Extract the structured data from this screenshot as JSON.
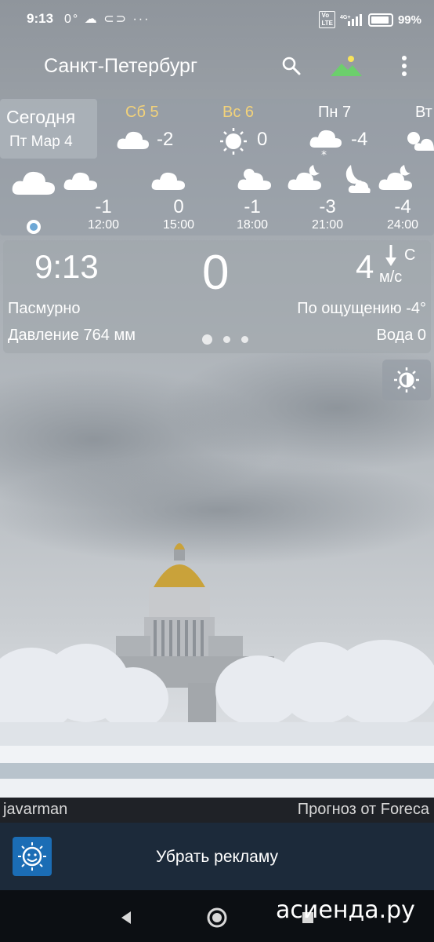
{
  "status_bar": {
    "time": "9:13",
    "temp_icon_text": "0°",
    "battery": "99%"
  },
  "header": {
    "city": "Санкт-Петербург"
  },
  "today": {
    "line1": "Сегодня",
    "line2": "Пт Мар 4"
  },
  "days": [
    {
      "name": "Сб 5",
      "temp": "-2",
      "icon": "cloudy-icon",
      "color": "#f2d27a"
    },
    {
      "name": "Вс 6",
      "temp": "0",
      "icon": "sun-icon",
      "color": "#f2d27a"
    },
    {
      "name": "Пн 7",
      "temp": "-4",
      "icon": "snow-cloud-icon",
      "color": "#ffffff"
    },
    {
      "name": "Вт",
      "temp": "",
      "icon": "partly-cloudy-icon",
      "color": "#ffffff"
    }
  ],
  "hours": [
    {
      "value": "-1",
      "time": "12:00"
    },
    {
      "value": "0",
      "time": "15:00"
    },
    {
      "value": "-1",
      "time": "18:00"
    },
    {
      "value": "-3",
      "time": "21:00"
    },
    {
      "value": "-4",
      "time": "24:00"
    }
  ],
  "current": {
    "time": "9:13",
    "temp": "0",
    "wind_speed": "4",
    "wind_dir": "С",
    "wind_unit": "м/с",
    "condition": "Пасмурно",
    "feels_like": "По ощущению -4°",
    "pressure": "Давление 764 мм",
    "water": "Вода 0"
  },
  "footer": {
    "photo_author": "javarman",
    "forecast_source": "Прогноз от Foreca",
    "remove_ads": "Убрать рекламу"
  },
  "watermark": "асиенда.ру"
}
